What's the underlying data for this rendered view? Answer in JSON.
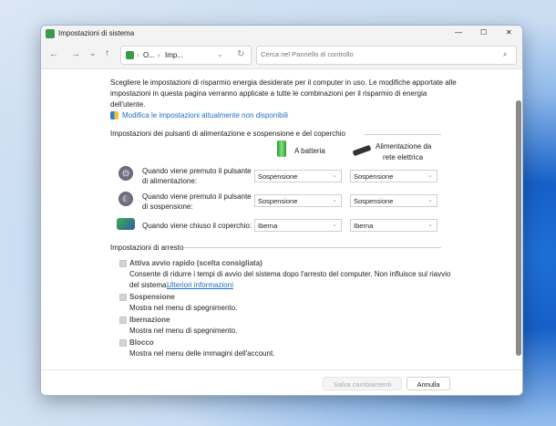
{
  "window": {
    "title": "Impostazioni di sistema",
    "minimize": "—",
    "maximize": "☐",
    "close": "✕"
  },
  "nav": {
    "back": "←",
    "forward": "→",
    "recent": "⌄",
    "up": "↑",
    "breadcrumb": [
      "O...",
      "Imp..."
    ],
    "refresh": "↻",
    "search_placeholder": "Cerca nel Pannello di controllo"
  },
  "intro": {
    "line1": "Scegliere le impostazioni di risparmio energia desiderate per il computer in uso. Le modifiche apportate alle",
    "line2": "impostazioni in questa pagina verranno applicate a tutte le combinazioni per il risparmio di energia",
    "line3": "dell'utente.",
    "admin_link": "Modifica le impostazioni attualmente non disponibili"
  },
  "buttons_section": {
    "heading": "Impostazioni dei pulsanti di alimentazione e sospensione e del coperchio",
    "col_battery": "A batteria",
    "col_ac_1": "Alimentazione da",
    "col_ac_2": "rete elettrica",
    "rows": [
      {
        "label1": "Quando viene premuto il pulsante",
        "label2": "di alimentazione:",
        "battery": "Sospensione",
        "ac": "Sospensione"
      },
      {
        "label1": "Quando viene premuto il pulsante",
        "label2": "di sospensione:",
        "battery": "Sospensione",
        "ac": "Sospensione"
      },
      {
        "label1": "Quando viene chiuso il coperchio:",
        "battery": "Iberna",
        "ac": "Iberna"
      }
    ]
  },
  "shutdown": {
    "heading": "Impostazioni di arresto",
    "fast_startup": {
      "label": "Attiva avvio rapido (scelta consigliata)",
      "desc1": "Consente di ridurre i tempi di avvio del sistema dopo l'arresto del computer. Non influisce sul riavvio",
      "desc2": "del sistema.",
      "link": "Ulteriori informazioni"
    },
    "sleep": {
      "label": "Sospensione",
      "desc": "Mostra nel menu di spegnimento."
    },
    "hibernate": {
      "label": "Ibernazione",
      "desc": "Mostra nel menu di spegnimento."
    },
    "lock": {
      "label": "Blocco",
      "desc": "Mostra nel menu delle immagini dell'account."
    }
  },
  "footer": {
    "save": "Salva cambiamenti",
    "cancel": "Annulla"
  }
}
